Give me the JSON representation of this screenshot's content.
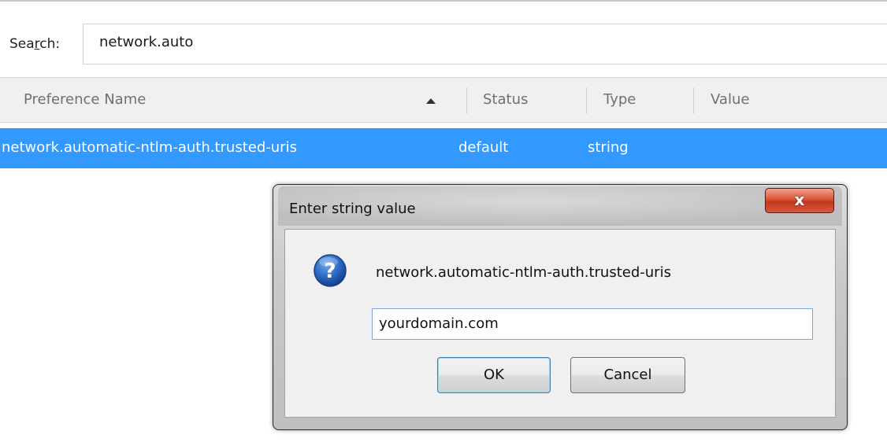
{
  "search": {
    "label_prefix": "Sea",
    "label_accel": "r",
    "label_suffix": "ch:",
    "value": "network.auto"
  },
  "columns": {
    "name": "Preference Name",
    "status": "Status",
    "type": "Type",
    "value": "Value"
  },
  "selected_row": {
    "name": "network.automatic-ntlm-auth.trusted-uris",
    "status": "default",
    "type": "string",
    "value": ""
  },
  "dialog": {
    "title": "Enter string value",
    "close_label": "x",
    "icon": "question-icon",
    "message": "network.automatic-ntlm-auth.trusted-uris",
    "input_value": "yourdomain.com",
    "ok_label": "OK",
    "cancel_label": "Cancel"
  },
  "colors": {
    "selection": "#3399ff",
    "header_bg": "#f0f0f0",
    "close_button": "#c2371c",
    "icon_blue": "#1f5fb4"
  }
}
